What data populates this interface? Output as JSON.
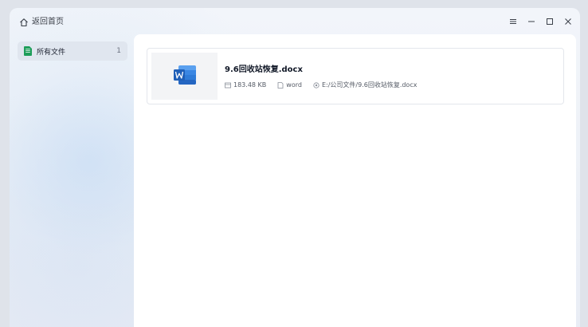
{
  "titlebar": {
    "back_label": "返回首页",
    "controls": [
      "menu-icon",
      "minimize-icon",
      "maximize-icon",
      "close-icon"
    ]
  },
  "sidebar": {
    "items": [
      {
        "label": "所有文件",
        "count": "1",
        "icon": "spreadsheet-file-icon",
        "icon_color": "#1e9e5a"
      }
    ]
  },
  "main": {
    "files": [
      {
        "name": "9.6回收站恢复.docx",
        "size": "183.48 KB",
        "type": "word",
        "path": "E:/公司文件/9.6回收站恢复.docx",
        "icon": "word-document-icon",
        "icon_color": "#2f7bd8"
      }
    ]
  },
  "colors": {
    "accent": "#2f7bd8",
    "sidebar_selected": "#e0e6ef"
  }
}
